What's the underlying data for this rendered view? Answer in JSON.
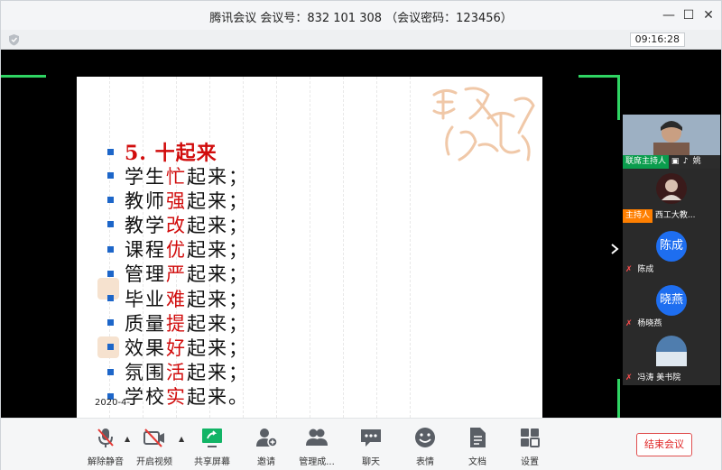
{
  "window": {
    "title": "腾讯会议 会议号：832 101 308 （会议密码：123456）",
    "controls": {
      "minimize": "—",
      "maximize": "☐",
      "close": "✕"
    }
  },
  "clock": "09:16:28",
  "slide": {
    "heading": "5. 十起来",
    "lines": [
      {
        "pre": "学生",
        "key": "忙",
        "post": "起来；"
      },
      {
        "pre": "教师",
        "key": "强",
        "post": "起来；"
      },
      {
        "pre": "教学",
        "key": "改",
        "post": "起来；"
      },
      {
        "pre": "课程",
        "key": "优",
        "post": "起来；"
      },
      {
        "pre": "管理",
        "key": "严",
        "post": "起来；"
      },
      {
        "pre": "毕业",
        "key": "难",
        "post": "起来；"
      },
      {
        "pre": "质量",
        "key": "提",
        "post": "起来；"
      },
      {
        "pre": "效果",
        "key": "好",
        "post": "起来；"
      },
      {
        "pre": "氛围",
        "key": "活",
        "post": "起来；"
      },
      {
        "pre": "学校",
        "key": "实",
        "post": "起来。"
      }
    ],
    "date": "2020-4-",
    "accent_color": "#d10c0c",
    "bullet_color": "#1d66c9"
  },
  "participants": [
    {
      "tag": "联席主持人",
      "name": "姚",
      "tag_color": "#0a9d4d"
    },
    {
      "tag": "主持人",
      "name": "西工大教...",
      "tag_color": "#ff7f00"
    },
    {
      "tag": "",
      "name": "陈成",
      "avatar_text": "陈成"
    },
    {
      "tag": "",
      "name": "杨晓燕",
      "avatar_text": "晓燕"
    },
    {
      "tag": "",
      "name": "冯涛 美书院"
    }
  ],
  "toolbar": {
    "unmute": "解除静音",
    "video": "开启视频",
    "share": "共享屏幕",
    "invite": "邀请",
    "members": "管理成...",
    "chat": "聊天",
    "reaction": "表情",
    "docs": "文档",
    "settings": "设置",
    "end": "结束会议"
  }
}
